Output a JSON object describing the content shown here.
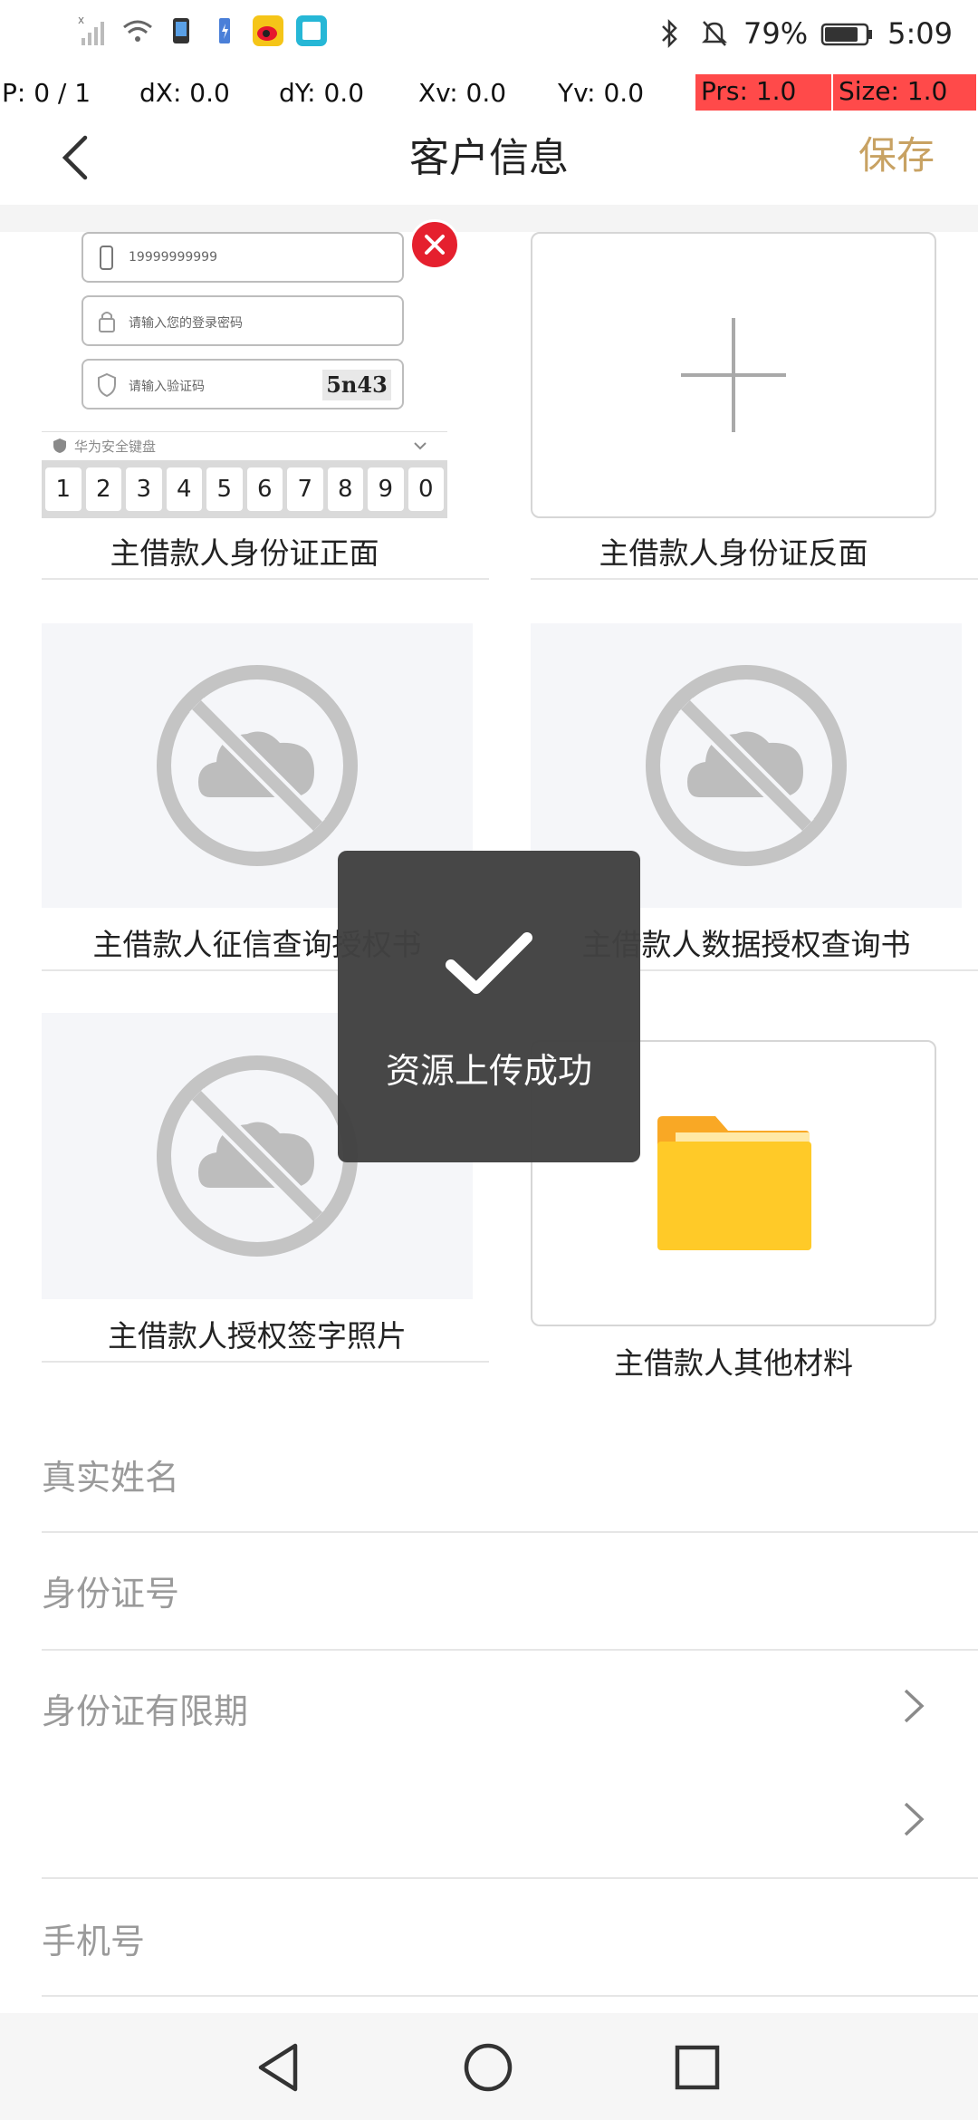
{
  "status_bar": {
    "battery_percent": "79%",
    "time": "5:09",
    "icons_left": [
      "signal-off-icon",
      "wifi-icon",
      "nfc-icon",
      "battery-saver-icon",
      "weibo-icon",
      "reader-app-icon"
    ],
    "icons_right": [
      "bluetooth-icon",
      "mute-icon",
      "battery-icon"
    ]
  },
  "debug_bar": {
    "p": "P: 0 / 1",
    "dx": "dX: 0.0",
    "dy": "dY: 0.0",
    "xv": "Xv: 0.0",
    "yv": "Yv: 0.0",
    "prs": "Prs: 1.0",
    "size": "Size: 1.0"
  },
  "header": {
    "title": "客户信息",
    "save_label": "保存"
  },
  "upload_grid": {
    "items": [
      {
        "label": "主借款人身份证正面",
        "state": "uploaded"
      },
      {
        "label": "主借款人身份证反面",
        "state": "empty-add"
      },
      {
        "label": "主借款人征信查询授权书",
        "state": "placeholder"
      },
      {
        "label": "主借款人数据授权查询书",
        "state": "placeholder"
      },
      {
        "label": "主借款人授权签字照片",
        "state": "placeholder"
      },
      {
        "label": "主借款人其他材料",
        "state": "folder"
      }
    ]
  },
  "thumbnail": {
    "phone": "19999999999",
    "password_placeholder": "请输入您的登录密码",
    "code_placeholder": "请输入验证码",
    "captcha": "5n43",
    "keyboard_title": "华为安全键盘",
    "keys": [
      "1",
      "2",
      "3",
      "4",
      "5",
      "6",
      "7",
      "8",
      "9",
      "0"
    ]
  },
  "toast": {
    "message": "资源上传成功"
  },
  "form": {
    "real_name": "真实姓名",
    "id_number": "身份证号",
    "id_validity": "身份证有限期",
    "phone": "手机号"
  },
  "colors": {
    "accent": "#c8a263",
    "remove": "#e5202e",
    "folder": "#ffca28",
    "toast_bg": "#414141",
    "debug_highlight": "#ff4a4a"
  }
}
